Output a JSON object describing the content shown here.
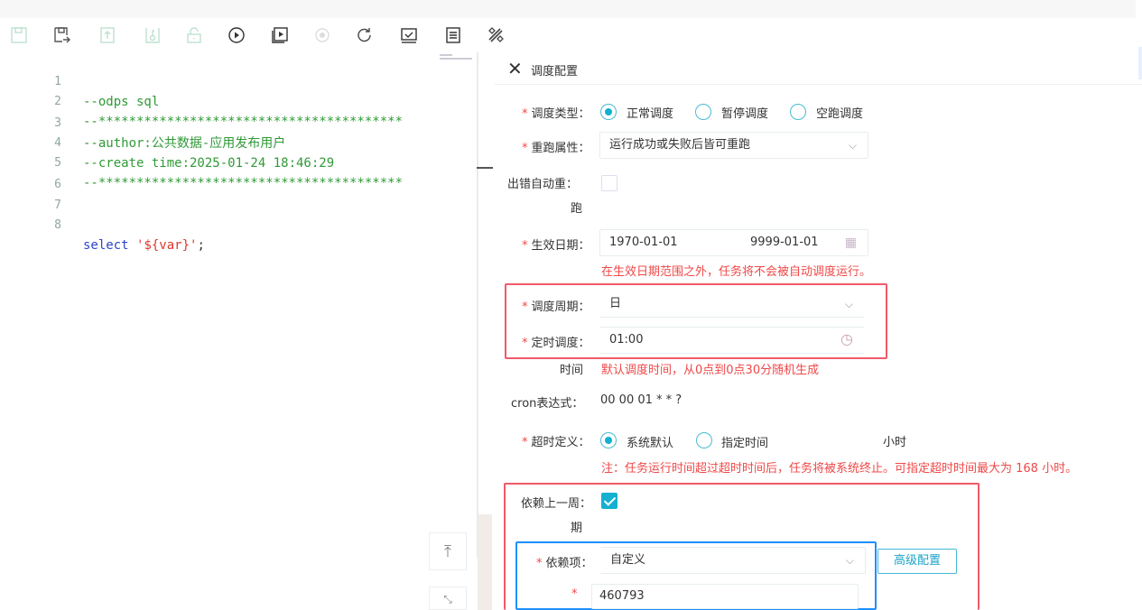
{
  "toolbar": {
    "icons": [
      {
        "name": "save-icon",
        "enabled": false
      },
      {
        "name": "save-as-icon",
        "enabled": true
      },
      {
        "name": "upload-icon",
        "enabled": false
      },
      {
        "name": "key-icon",
        "enabled": false
      },
      {
        "name": "unlock-icon",
        "enabled": false
      },
      {
        "name": "run-icon",
        "enabled": true
      },
      {
        "name": "run-advanced-icon",
        "enabled": true
      },
      {
        "name": "stop-icon",
        "enabled": false
      },
      {
        "name": "refresh-icon",
        "enabled": true
      },
      {
        "name": "check-icon",
        "enabled": true
      },
      {
        "name": "format-icon",
        "enabled": true
      },
      {
        "name": "tools-icon",
        "enabled": true
      }
    ]
  },
  "editor": {
    "lines": [
      {
        "no": "1",
        "text": "--odps sql"
      },
      {
        "no": "2",
        "text": "--****************************************"
      },
      {
        "no": "3",
        "text": "--author:公共数据-应用发布用户"
      },
      {
        "no": "4",
        "text": "--create time:2025-01-24 18:46:29"
      },
      {
        "no": "5",
        "text": "--****************************************"
      },
      {
        "no": "6",
        "text": ""
      },
      {
        "no": "7",
        "text": ""
      },
      {
        "no": "8",
        "kw": "select",
        "str": "'${var}'",
        "punc": ";"
      }
    ]
  },
  "panel": {
    "title": "调度配置",
    "schedule_type": {
      "label": "调度类型：",
      "options": [
        "正常调度",
        "暂停调度",
        "空跑调度"
      ],
      "selected": "正常调度"
    },
    "rerun": {
      "label": "重跑属性：",
      "value": "运行成功或失败后皆可重跑"
    },
    "auto_rerun": {
      "label_line1": "出错自动重：",
      "label_line2": "跑",
      "checked": false
    },
    "effective_date": {
      "label": "生效日期：",
      "start": "1970-01-01",
      "end": "9999-01-01",
      "hint": "在生效日期范围之外，任务将不会被自动调度运行。"
    },
    "cycle": {
      "label": "调度周期：",
      "value": "日"
    },
    "timed": {
      "label": "定时调度：",
      "value": "01:00",
      "label_line2": "时间",
      "hint": "默认调度时间，从0点到0点30分随机生成"
    },
    "cron": {
      "label": "cron表达式：",
      "value": "00 00 01 * * ?"
    },
    "timeout": {
      "label": "超时定义：",
      "options": [
        "系统默认",
        "指定时间"
      ],
      "selected": "系统默认",
      "unit": "小时",
      "hint": "注：任务运行时间超过超时时间后，任务将被系统终止。可指定超时时间最大为 168 小时。"
    },
    "depend_prev": {
      "label_line1": "依赖上一周：",
      "label_line2": "期",
      "checked": true
    },
    "depend_item": {
      "label": "依赖项：",
      "value": "自定义",
      "advanced_button": "高级配置"
    },
    "depend_value": {
      "value": "460793"
    }
  }
}
